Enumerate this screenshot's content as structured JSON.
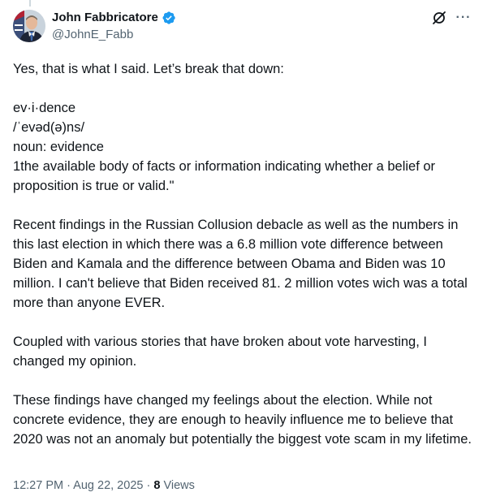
{
  "author": {
    "display_name": "John Fabbricatore",
    "handle": "@JohnE_Fabb",
    "verified": true,
    "verified_color": "#1d9bf0"
  },
  "icons": {
    "grok": "grok-icon",
    "more": "more-options-icon",
    "verified": "verified-badge-icon"
  },
  "more_glyph": "···",
  "tweet": {
    "text": "Yes, that is what I said. Let’s break that down:\n\nev·i·dence\n/ˈevəd(ə)ns/\nnoun: evidence\n1the available body of facts or information indicating whether a belief or proposition is true or valid.\"\n\nRecent findings in the Russian Collusion debacle as well as the numbers in this last election in which there was a 6.8 million vote difference between Biden and Kamala and the difference between Obama and Biden was 10 million. I can't believe that Biden received 81. 2 million votes wich was a total more than anyone EVER.\n\nCoupled with various stories that have broken about vote harvesting, I changed my opinion.\n\nThese findings have changed my feelings about the election. While not concrete evidence, they are enough to heavily influence me to believe that 2020 was not an anomaly but potentially the biggest vote scam in my lifetime."
  },
  "meta": {
    "time": "12:27 PM",
    "separator": " · ",
    "date": "Aug 22, 2025",
    "views_count": "8",
    "views_label": " Views"
  },
  "colors": {
    "text": "#0f1419",
    "secondary": "#536471",
    "accent": "#1d9bf0"
  }
}
